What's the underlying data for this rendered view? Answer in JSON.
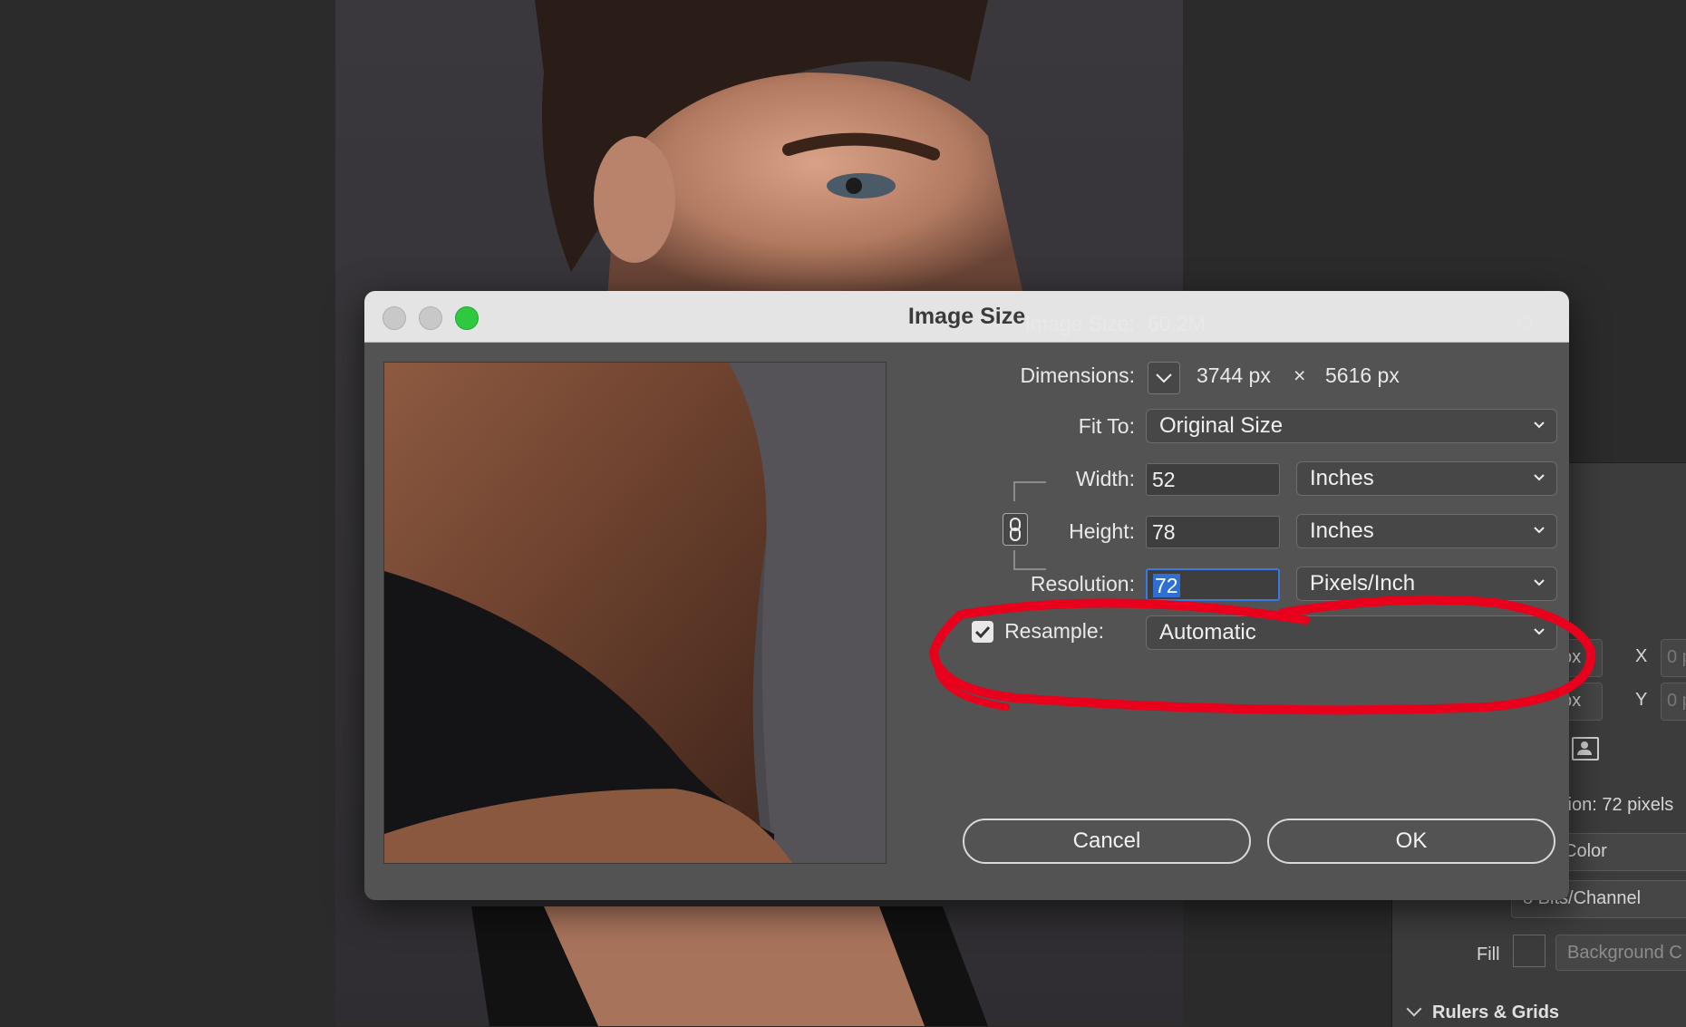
{
  "dialog": {
    "title": "Image Size",
    "image_size_label": "Image Size:",
    "image_size_value": "60.2M",
    "dimensions_label": "Dimensions:",
    "dimensions_width": "3744 px",
    "dimensions_x": "×",
    "dimensions_height": "5616 px",
    "fit_to_label": "Fit To:",
    "fit_to_value": "Original Size",
    "width_label": "Width:",
    "width_value": "52",
    "width_unit": "Inches",
    "height_label": "Height:",
    "height_value": "78",
    "height_unit": "Inches",
    "resolution_label": "Resolution:",
    "resolution_value": "72",
    "resolution_unit": "Pixels/Inch",
    "resample_label": "Resample:",
    "resample_checked": true,
    "resample_value": "Automatic",
    "cancel_label": "Cancel",
    "ok_label": "OK"
  },
  "props_panel": {
    "x_label": "X",
    "y_label": "Y",
    "x_value": "0 p",
    "y_value": "0 p",
    "w_unit": "px",
    "h_unit": "px",
    "resolution_text": "tion: 72 pixels",
    "mode_text": "Color",
    "depth_text": "8 Bits/Channel",
    "fill_label": "Fill",
    "fill_value": "Background C",
    "section_title": "Rulers & Grids"
  },
  "colors": {
    "annotation_red": "#e8001c",
    "close": "#c9c9c9",
    "minimize": "#c9c9c9",
    "zoom": "#2ec93f",
    "selection": "#2f6fd1"
  }
}
